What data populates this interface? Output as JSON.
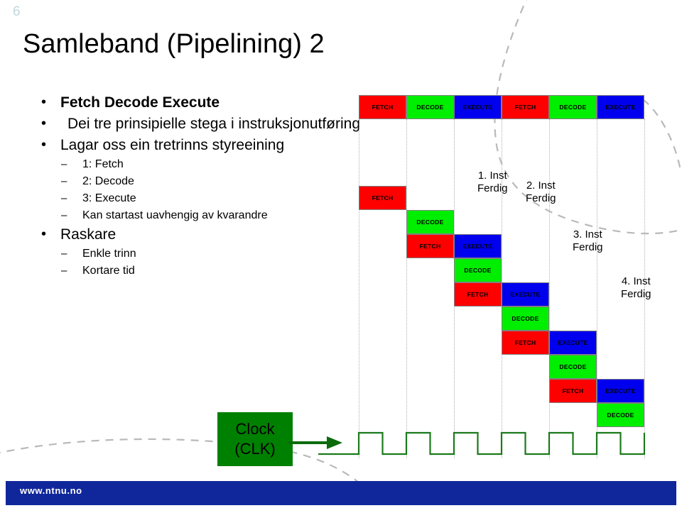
{
  "slide": {
    "number": "6",
    "title": "Samleband (Pipelining) 2"
  },
  "bullets": [
    {
      "level": 1,
      "marker": "•",
      "text": "Fetch Decode Execute",
      "bold": true
    },
    {
      "level": 1,
      "marker": "•",
      "text": "Dei tre prinsipielle stega i instruksjonutføring",
      "bold": false,
      "indent": true
    },
    {
      "level": 1,
      "marker": "•",
      "text": "Lagar oss ein tretrinns styreeining",
      "bold": false
    },
    {
      "level": 2,
      "marker": "–",
      "text": "1: Fetch"
    },
    {
      "level": 2,
      "marker": "–",
      "text": "2: Decode"
    },
    {
      "level": 2,
      "marker": "–",
      "text": "3: Execute"
    },
    {
      "level": 2,
      "marker": "–",
      "text": "Kan startast uavhengig av kvarandre"
    },
    {
      "level": 1,
      "marker": "•",
      "text": "Raskare",
      "bold": false
    },
    {
      "level": 2,
      "marker": "–",
      "text": "Enkle trinn"
    },
    {
      "level": 2,
      "marker": "–",
      "text": "Kortare tid"
    }
  ],
  "colors": {
    "fetch": "#ff0000",
    "decode": "#00ee00",
    "execute": "#0000ee",
    "clock_box": "#008000",
    "clock_wave": "#1a7a1a",
    "footer_bar": "#10279b",
    "slide_number": "#c2d6de"
  },
  "stage_labels": {
    "fetch": "FETCH",
    "decode": "DECODE",
    "execute": "EXECUTE"
  },
  "sequential_row": {
    "caption": "",
    "blocks": [
      {
        "stage": "FETCH",
        "kind": "fetch",
        "col": 0
      },
      {
        "stage": "DECODE",
        "kind": "decode",
        "col": 1
      },
      {
        "stage": "EXECUTE",
        "kind": "execute",
        "col": 2
      },
      {
        "stage": "FETCH",
        "kind": "fetch",
        "col": 3
      },
      {
        "stage": "DECODE",
        "kind": "decode",
        "col": 4
      },
      {
        "stage": "EXECUTE",
        "kind": "execute",
        "col": 5
      }
    ]
  },
  "pipeline_staircase": {
    "blocks": [
      {
        "stage": "FETCH",
        "kind": "fetch",
        "col": 0,
        "row": 0
      },
      {
        "stage": "DECODE",
        "kind": "decode",
        "col": 1,
        "row": 1
      },
      {
        "stage": "FETCH",
        "kind": "fetch",
        "col": 1,
        "row": 2
      },
      {
        "stage": "EXECUTE",
        "kind": "execute",
        "col": 2,
        "row": 2
      },
      {
        "stage": "DECODE",
        "kind": "decode",
        "col": 2,
        "row": 3
      },
      {
        "stage": "FETCH",
        "kind": "fetch",
        "col": 2,
        "row": 4
      },
      {
        "stage": "EXECUTE",
        "kind": "execute",
        "col": 3,
        "row": 4
      },
      {
        "stage": "DECODE",
        "kind": "decode",
        "col": 3,
        "row": 5
      },
      {
        "stage": "FETCH",
        "kind": "fetch",
        "col": 3,
        "row": 6
      },
      {
        "stage": "EXECUTE",
        "kind": "execute",
        "col": 4,
        "row": 6
      },
      {
        "stage": "DECODE",
        "kind": "decode",
        "col": 4,
        "row": 7
      },
      {
        "stage": "FETCH",
        "kind": "fetch",
        "col": 4,
        "row": 8
      },
      {
        "stage": "EXECUTE",
        "kind": "execute",
        "col": 5,
        "row": 8
      },
      {
        "stage": "DECODE",
        "kind": "decode",
        "col": 5,
        "row": 9
      }
    ]
  },
  "instruction_markers": [
    {
      "line1": "1. Inst",
      "line2": "Ferdig",
      "tick_col": 3
    },
    {
      "line1": "2. Inst",
      "line2": "Ferdig",
      "tick_col": 4
    },
    {
      "line1": "3. Inst",
      "line2": "Ferdig",
      "tick_col": 5
    },
    {
      "line1": "4. Inst",
      "line2": "Ferdig",
      "tick_col": 6
    }
  ],
  "clock": {
    "label_line1": "Clock",
    "label_line2": "(CLK)",
    "cycles": 6
  },
  "footer": {
    "url": "www.ntnu.no"
  }
}
